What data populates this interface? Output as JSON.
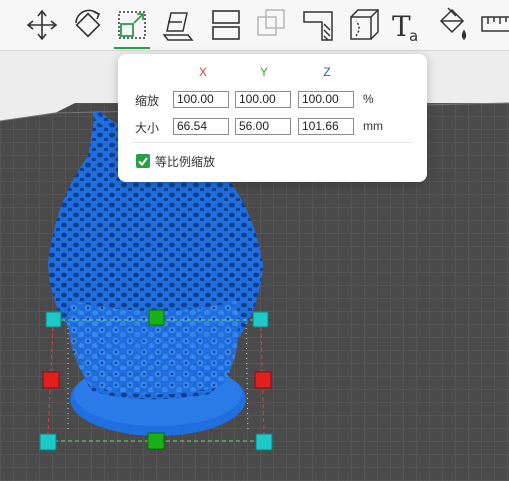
{
  "toolbar": {
    "tools": [
      {
        "name": "move-tool-icon",
        "active": false
      },
      {
        "name": "rotate-tool-icon",
        "active": false
      },
      {
        "name": "scale-tool-icon",
        "active": true
      },
      {
        "name": "lay-on-face-icon",
        "active": false
      },
      {
        "name": "split-object-icon",
        "active": false
      },
      {
        "name": "boolean-icon",
        "active": false
      },
      {
        "name": "measure-cut-icon",
        "active": false
      },
      {
        "name": "cube-icon",
        "active": false
      },
      {
        "name": "text-tool-icon",
        "active": false
      },
      {
        "name": "paint-bucket-icon",
        "active": false
      },
      {
        "name": "ruler-icon",
        "active": false
      }
    ],
    "active_color": "#2c9c4a"
  },
  "scale_panel": {
    "axes": {
      "x": "X",
      "y": "Y",
      "z": "Z"
    },
    "scale_label": "缩放",
    "size_label": "大小",
    "scale": {
      "x": "100.00",
      "y": "100.00",
      "z": "100.00",
      "unit": "%"
    },
    "size": {
      "x": "66.54",
      "y": "56.00",
      "z": "101.66",
      "unit": "mm"
    },
    "uniform_label": "等比例缩放",
    "uniform_checked": true,
    "axis_colors": {
      "x": "#d64545",
      "y": "#3f9b3f",
      "z": "#2e57b8"
    }
  },
  "viewport": {
    "model_color": "#1f6fe0",
    "bed_color": "#4a4a4a",
    "handle_colors": {
      "corner": "#1ec8c8",
      "side_x": "#e0201e",
      "side_y": "#19b019"
    }
  }
}
